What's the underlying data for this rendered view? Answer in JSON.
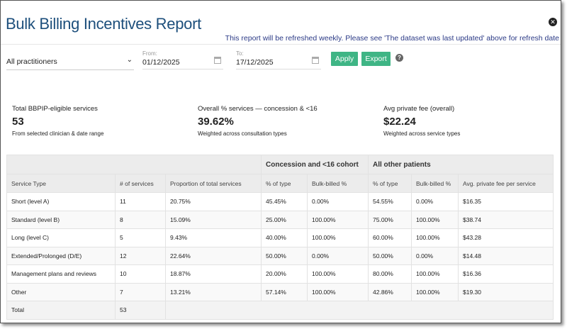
{
  "header": {
    "title": "Bulk Billing Incentives Report",
    "notice": "This report will be refreshed weekly. Please see 'The dataset was last updated' above for refresh date"
  },
  "filters": {
    "practitioner": "All practitioners",
    "from_label": "From:",
    "from_value": "01/12/2025",
    "to_label": "To:",
    "to_value": "17/12/2025",
    "apply": "Apply",
    "export": "Export",
    "help": "?"
  },
  "colors": {
    "title": "#1d4f7c",
    "button": "#3fb585",
    "notice": "#2b3a86"
  },
  "kpis": [
    {
      "label": "Total BBPIP-eligible services",
      "value": "53",
      "sub": "From selected clinician & date range"
    },
    {
      "label": "Overall % services — concession & <16",
      "value": "39.62%",
      "sub": "Weighted across consultation types"
    },
    {
      "label": "Avg private fee (overall)",
      "value": "$22.24",
      "sub": "Weighted across service types"
    }
  ],
  "table": {
    "groups": [
      "Concession and <16 cohort",
      "All other patients"
    ],
    "columns": [
      "Service Type",
      "# of services",
      "Proportion of total services",
      "% of type",
      "Bulk-billed %",
      "% of type",
      "Bulk-billed %",
      "Avg. private fee per service"
    ],
    "rows": [
      [
        "Short (level A)",
        "11",
        "20.75%",
        "45.45%",
        "0.00%",
        "54.55%",
        "0.00%",
        "$16.35"
      ],
      [
        "Standard (level B)",
        "8",
        "15.09%",
        "25.00%",
        "100.00%",
        "75.00%",
        "100.00%",
        "$38.74"
      ],
      [
        "Long (level C)",
        "5",
        "9.43%",
        "40.00%",
        "100.00%",
        "60.00%",
        "100.00%",
        "$43.28"
      ],
      [
        "Extended/Prolonged (D/E)",
        "12",
        "22.64%",
        "50.00%",
        "0.00%",
        "50.00%",
        "0.00%",
        "$14.48"
      ],
      [
        "Management plans and reviews",
        "10",
        "18.87%",
        "20.00%",
        "100.00%",
        "80.00%",
        "100.00%",
        "$16.36"
      ],
      [
        "Other",
        "7",
        "13.21%",
        "57.14%",
        "100.00%",
        "42.86%",
        "100.00%",
        "$19.30"
      ]
    ],
    "total": {
      "label": "Total",
      "value": "53"
    }
  }
}
